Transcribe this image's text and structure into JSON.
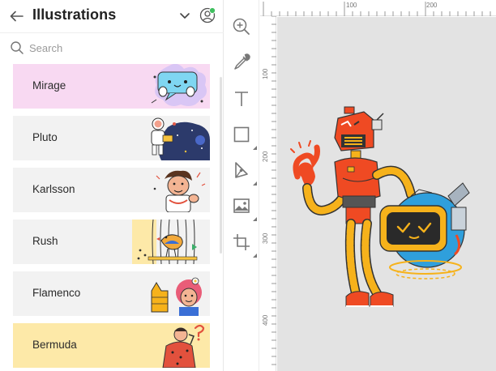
{
  "panel": {
    "title": "Illustrations",
    "search_placeholder": "Search",
    "cards": [
      {
        "label": "Mirage",
        "bg": "#f8d9f2"
      },
      {
        "label": "Pluto",
        "bg": "#f2f2f2"
      },
      {
        "label": "Karlsson",
        "bg": "#f2f2f2"
      },
      {
        "label": "Rush",
        "bg": "#f2f2f2"
      },
      {
        "label": "Flamenco",
        "bg": "#f2f2f2"
      },
      {
        "label": "Bermuda",
        "bg": "#fde9a8"
      }
    ]
  },
  "toolbar": {
    "tools": [
      "zoom-icon",
      "pen-icon",
      "text-icon",
      "rectangle-icon",
      "vector-pen-icon",
      "image-icon",
      "crop-icon"
    ]
  },
  "rulers": {
    "top_labels": [
      "100",
      "200"
    ],
    "left_labels": [
      "100",
      "200",
      "300",
      "400"
    ]
  },
  "colors": {
    "accent_green": "#3fbf5f",
    "robot_orange": "#ef4a23",
    "robot_yellow": "#f6b21b",
    "robot_blue": "#2f9fdc"
  }
}
